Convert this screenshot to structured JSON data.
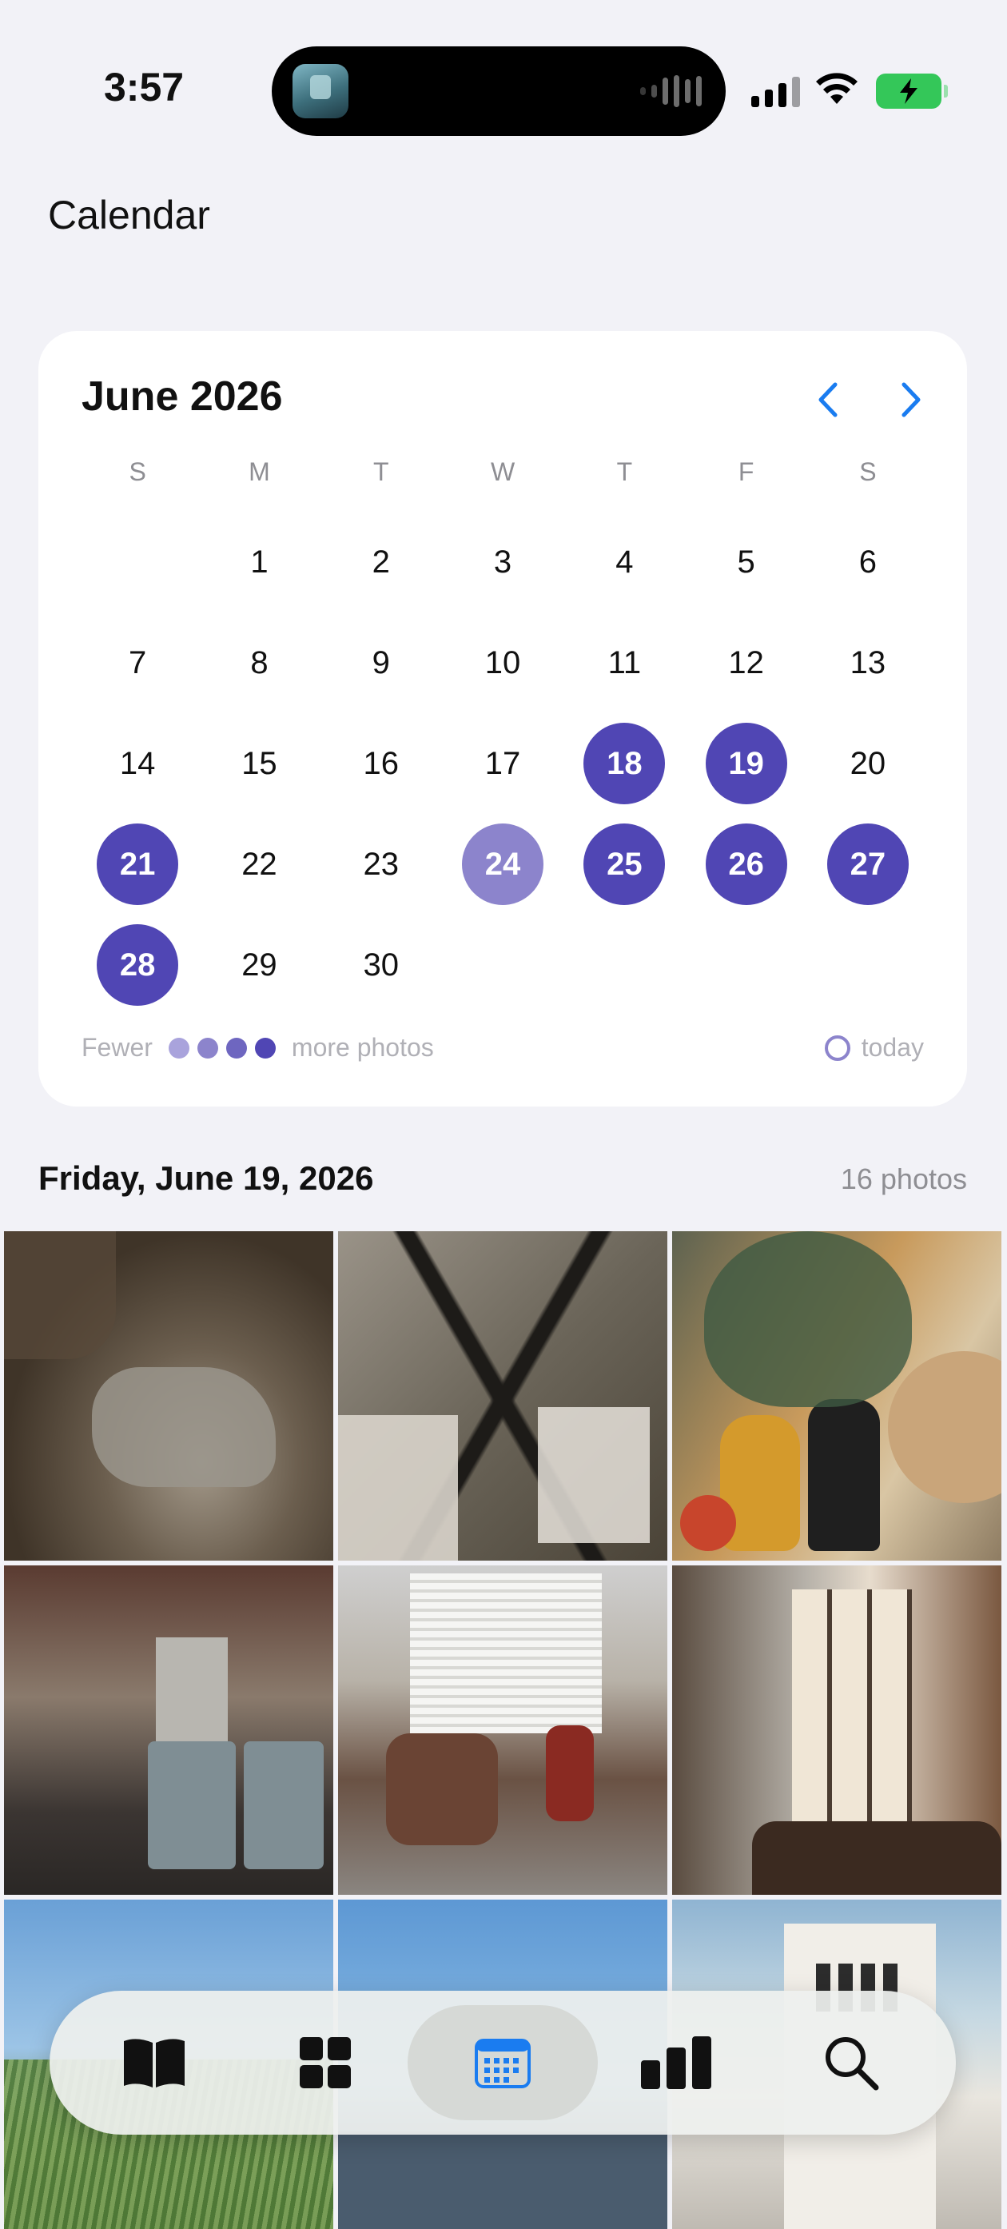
{
  "status_bar": {
    "time": "3:57"
  },
  "page": {
    "title": "Calendar"
  },
  "calendar": {
    "month_title": "June 2026",
    "weekdays": [
      "S",
      "M",
      "T",
      "W",
      "T",
      "F",
      "S"
    ],
    "days": [
      {
        "label": "",
        "level": "none"
      },
      {
        "label": "1",
        "level": "none"
      },
      {
        "label": "2",
        "level": "none"
      },
      {
        "label": "3",
        "level": "none"
      },
      {
        "label": "4",
        "level": "none"
      },
      {
        "label": "5",
        "level": "none"
      },
      {
        "label": "6",
        "level": "none"
      },
      {
        "label": "7",
        "level": "none"
      },
      {
        "label": "8",
        "level": "none"
      },
      {
        "label": "9",
        "level": "none"
      },
      {
        "label": "10",
        "level": "none"
      },
      {
        "label": "11",
        "level": "none"
      },
      {
        "label": "12",
        "level": "none"
      },
      {
        "label": "13",
        "level": "none"
      },
      {
        "label": "14",
        "level": "none"
      },
      {
        "label": "15",
        "level": "none"
      },
      {
        "label": "16",
        "level": "none"
      },
      {
        "label": "17",
        "level": "none"
      },
      {
        "label": "18",
        "level": "high"
      },
      {
        "label": "19",
        "level": "high"
      },
      {
        "label": "20",
        "level": "none"
      },
      {
        "label": "21",
        "level": "high"
      },
      {
        "label": "22",
        "level": "none"
      },
      {
        "label": "23",
        "level": "none"
      },
      {
        "label": "24",
        "level": "low"
      },
      {
        "label": "25",
        "level": "high"
      },
      {
        "label": "26",
        "level": "high"
      },
      {
        "label": "27",
        "level": "high"
      },
      {
        "label": "28",
        "level": "high"
      },
      {
        "label": "29",
        "level": "none"
      },
      {
        "label": "30",
        "level": "none"
      }
    ],
    "legend": {
      "fewer_label": "Fewer",
      "more_label": "more photos",
      "today_label": "today",
      "dot_colors": [
        "#a9a3dc",
        "#8c84cc",
        "#6e66c0",
        "#5046b4"
      ]
    },
    "colors": {
      "accent": "#5046b4",
      "nav": "#1a7cf0"
    }
  },
  "section": {
    "title": "Friday, June 19, 2026",
    "count": "16 photos"
  },
  "photos": [
    "photo-blanket-sock",
    "photo-drying-rack",
    "photo-vase-plant",
    "photo-kitchen",
    "photo-armchair-office",
    "photo-door-window",
    "photo-sky-field",
    "photo-sky-water",
    "photo-church-tower"
  ],
  "tab_bar": {
    "items": [
      {
        "icon": "book-icon",
        "active": false
      },
      {
        "icon": "grid-icon",
        "active": false
      },
      {
        "icon": "calendar-icon",
        "active": true
      },
      {
        "icon": "bar-chart-icon",
        "active": false
      },
      {
        "icon": "search-icon",
        "active": false
      }
    ]
  }
}
